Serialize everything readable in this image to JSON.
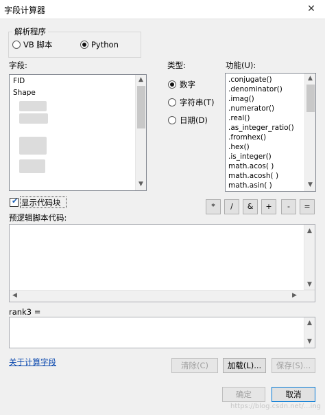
{
  "window": {
    "title": "字段计算器",
    "close_glyph": "✕"
  },
  "parser": {
    "label": "解析程序",
    "options": [
      {
        "label": "VB 脚本",
        "selected": false
      },
      {
        "label": "Python",
        "selected": true
      }
    ]
  },
  "fields": {
    "label": "字段:",
    "items": [
      "FID",
      "Shape"
    ]
  },
  "type": {
    "label": "类型:",
    "options": [
      {
        "label": "数字",
        "selected": true
      },
      {
        "label": "字符串(T)",
        "selected": false
      },
      {
        "label": "日期(D)",
        "selected": false
      }
    ]
  },
  "functions": {
    "label": "功能(U):",
    "items": [
      ".conjugate()",
      ".denominator()",
      ".imag()",
      ".numerator()",
      ".real()",
      ".as_integer_ratio()",
      ".fromhex()",
      ".hex()",
      ".is_integer()",
      "math.acos( )",
      "math.acosh( )",
      "math.asin( )"
    ]
  },
  "show_codeblock": {
    "label": "显示代码块",
    "checked": true
  },
  "operators": [
    "*",
    "/",
    "&",
    "+",
    "-",
    "="
  ],
  "pre_logic": {
    "label": "预逻辑脚本代码:",
    "value": ""
  },
  "expression": {
    "label": "rank3 =",
    "value": ""
  },
  "about_link": "关于计算字段",
  "buttons": {
    "clear": "清除(C)",
    "load": "加载(L)...",
    "save": "保存(S)...",
    "ok": "确定",
    "cancel": "取消"
  },
  "watermark": "https://blog.csdn.net/...ing"
}
